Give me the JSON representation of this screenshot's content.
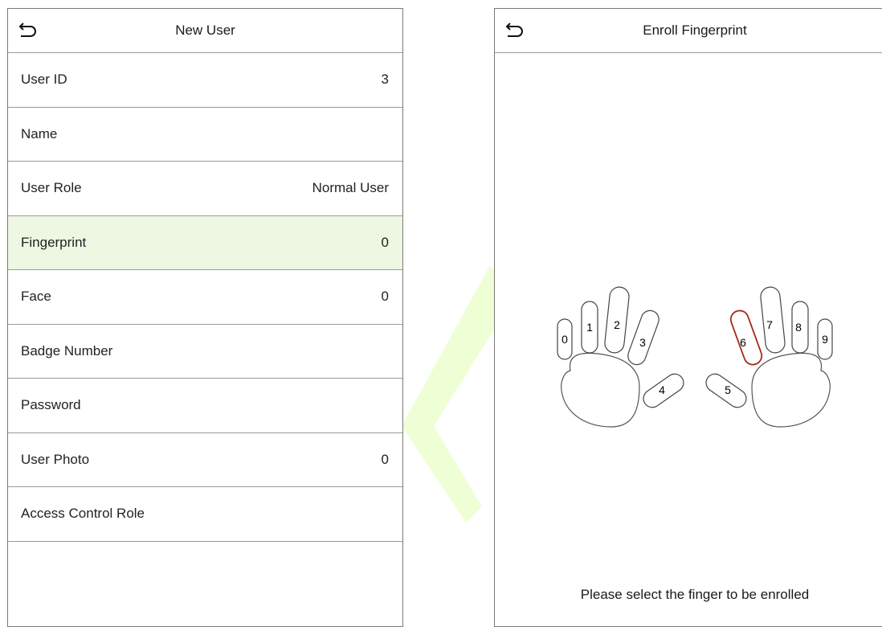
{
  "new_user": {
    "title": "New User",
    "rows": [
      {
        "label": "User ID",
        "value": "3"
      },
      {
        "label": "Name",
        "value": ""
      },
      {
        "label": "User Role",
        "value": "Normal User"
      },
      {
        "label": "Fingerprint",
        "value": "0",
        "selected": true
      },
      {
        "label": "Face",
        "value": "0"
      },
      {
        "label": "Badge Number",
        "value": ""
      },
      {
        "label": "Password",
        "value": ""
      },
      {
        "label": "User Photo",
        "value": "0"
      },
      {
        "label": "Access Control Role",
        "value": ""
      }
    ]
  },
  "enroll": {
    "title": "Enroll Fingerprint",
    "fingers": [
      "0",
      "1",
      "2",
      "3",
      "4",
      "5",
      "6",
      "7",
      "8",
      "9"
    ],
    "highlighted_finger": "6",
    "highlight_color": "#a52a1a",
    "prompt": "Please select the finger to be enrolled"
  },
  "colors": {
    "selected_row_bg": "#edf7e2",
    "watermark": "#e8ffc8"
  }
}
